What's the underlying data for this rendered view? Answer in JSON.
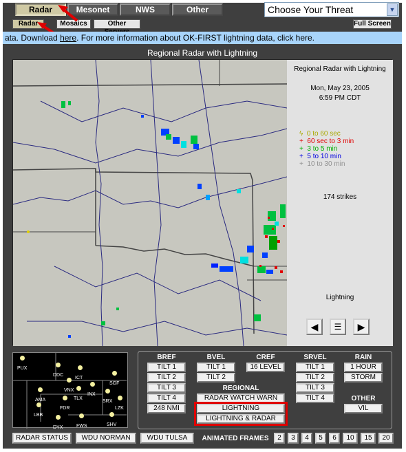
{
  "tabs": {
    "radar": "Radar",
    "mesonet": "Mesonet",
    "nws": "NWS",
    "other": "Other"
  },
  "threat_select": {
    "value": "Choose Your Threat"
  },
  "subtabs": {
    "radar": "Radar",
    "mosaics": "Mosaics",
    "other_servers": "Other Servers",
    "full_screen": "Full Screen"
  },
  "ticker": {
    "prefix": "ata. Download ",
    "link": "here",
    "suffix": ". For more information about OK-FIRST lightning data, click here."
  },
  "title": "Regional Radar with Lightning",
  "legend": {
    "title": "Regional Radar with Lightning",
    "date": "Mon, May 23, 2005",
    "time": "6:59 PM CDT",
    "items": [
      {
        "symbol": "ϟ",
        "label": "0 to 60 sec",
        "color": "#a8a800"
      },
      {
        "symbol": "+",
        "label": "60 sec to 3 min",
        "color": "#e00000"
      },
      {
        "symbol": "+",
        "label": "3 to 5 min",
        "color": "#00b000"
      },
      {
        "symbol": "+",
        "label": "5 to 10 min",
        "color": "#0000e0"
      },
      {
        "symbol": "+",
        "label": "10 to 30 min",
        "color": "#909090"
      }
    ],
    "strikes": "174 strikes",
    "product": "Lightning"
  },
  "stations": [
    "PUX",
    "DDC",
    "ICT",
    "SGF",
    "VNX",
    "INX",
    "AMA",
    "TLX",
    "SRX",
    "LZK",
    "LBB",
    "FDR",
    "DYX",
    "FWS",
    "SHV"
  ],
  "products": {
    "bref": {
      "label": "BREF",
      "items": [
        "TILT 1",
        "TILT 2",
        "TILT 3",
        "TILT 4",
        "248 NMI"
      ]
    },
    "bvel": {
      "label": "BVEL",
      "items": [
        "TILT 1",
        "TILT 2"
      ]
    },
    "cref": {
      "label": "CREF",
      "items": [
        "16 LEVEL"
      ]
    },
    "srvel": {
      "label": "SRVEL",
      "items": [
        "TILT 1",
        "TILT 2",
        "TILT 3",
        "TILT 4"
      ]
    },
    "rain": {
      "label": "RAIN",
      "items": [
        "1 HOUR",
        "STORM"
      ]
    },
    "other": {
      "label": "OTHER",
      "items": [
        "VIL"
      ]
    },
    "regional": {
      "label": "REGIONAL",
      "items": [
        "RADAR WATCH WARN",
        "LIGHTNING",
        "LIGHTNING & RADAR"
      ]
    }
  },
  "bottom": {
    "radar_status": "RADAR STATUS",
    "wdu_norman": "WDU NORMAN",
    "wdu_tulsa": "WDU TULSA",
    "animated_label": "ANIMATED FRAMES",
    "frames": [
      "2",
      "3",
      "4",
      "5",
      "6",
      "10",
      "15",
      "20"
    ]
  }
}
